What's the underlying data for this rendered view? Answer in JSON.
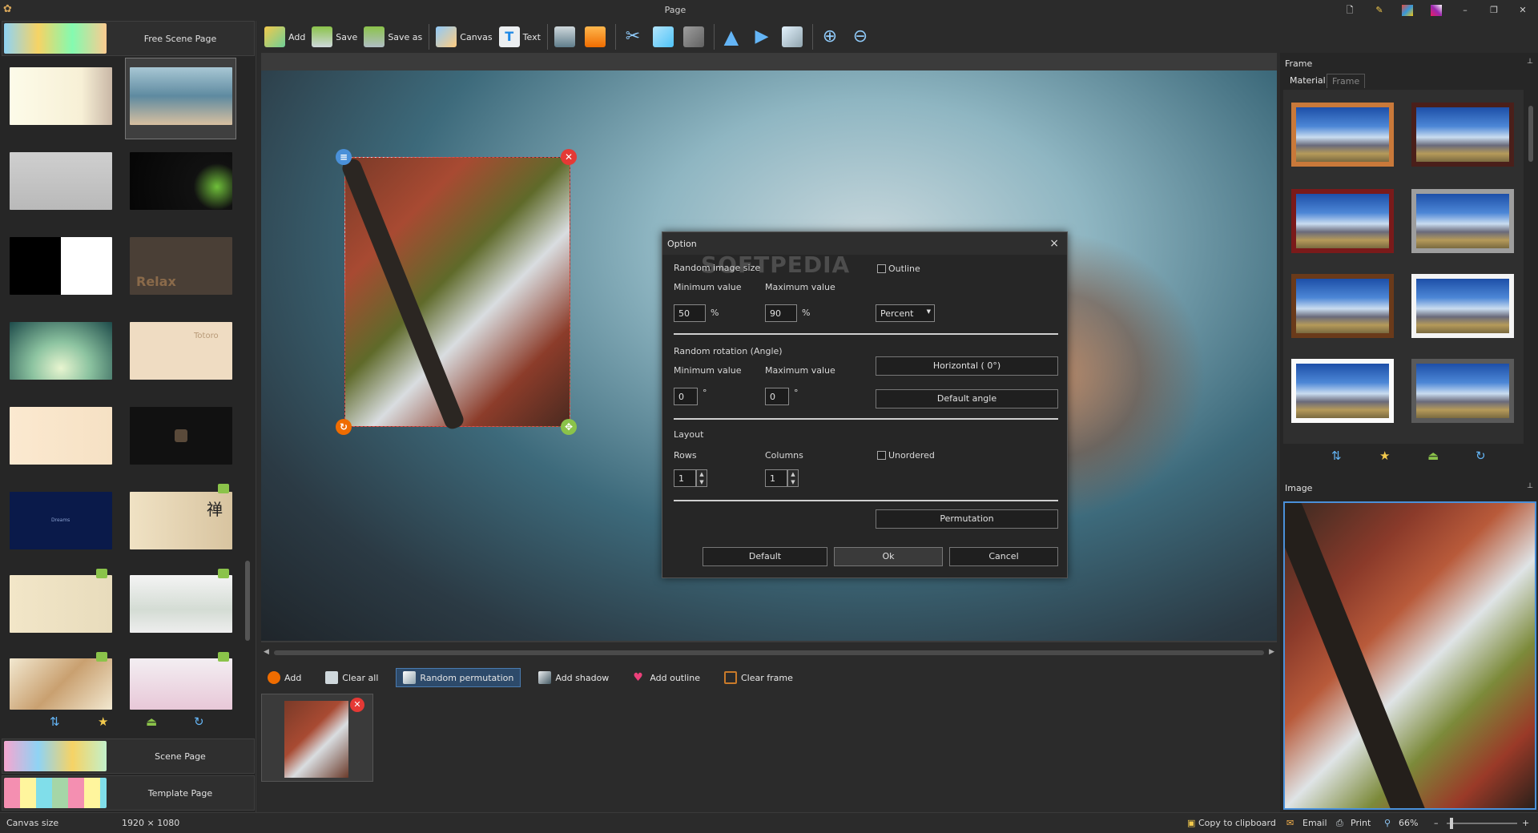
{
  "window": {
    "title": "Page"
  },
  "toolbar": {
    "add": "Add",
    "save": "Save",
    "save_as": "Save as",
    "canvas": "Canvas",
    "text": "Text"
  },
  "left_panel": {
    "free_scene": "Free Scene Page",
    "scene": "Scene Page",
    "template": "Template Page",
    "thumb_text": {
      "relax": "Relax",
      "totoro": "Totoro",
      "dreams": "Dreams",
      "zen": "禅"
    }
  },
  "bottom_bar": {
    "add": "Add",
    "clear_all": "Clear all",
    "random_permutation": "Random permutation",
    "add_shadow": "Add shadow",
    "add_outline": "Add outline",
    "clear_frame": "Clear frame"
  },
  "right_panel": {
    "frame_header": "Frame",
    "tabs": [
      "Material",
      "Frame"
    ],
    "image_header": "Image"
  },
  "dialog": {
    "title": "Option",
    "close": "×",
    "watermark": "SOFTPEDIA",
    "random_size": "Random image size",
    "min_label": "Minimum value",
    "max_label": "Maximum value",
    "min_size": "50",
    "max_size": "90",
    "percent_sign": "%",
    "outline": "Outline",
    "unit_select": "Percent",
    "random_rotation": "Random rotation (Angle)",
    "min_angle": "0",
    "max_angle": "0",
    "degree": "°",
    "horizontal_btn": "Horizontal ( 0°)",
    "default_angle_btn": "Default angle",
    "layout": "Layout",
    "rows_label": "Rows",
    "columns_label": "Columns",
    "rows": "1",
    "columns": "1",
    "unordered": "Unordered",
    "permutation_btn": "Permutation",
    "default_btn": "Default",
    "ok_btn": "Ok",
    "cancel_btn": "Cancel"
  },
  "status": {
    "canvas_size_label": "Canvas size",
    "canvas_size": "1920 × 1080",
    "copy": "Copy to clipboard",
    "email": "Email",
    "print": "Print",
    "zoom": "66%",
    "minus": "–",
    "plus": "+"
  }
}
